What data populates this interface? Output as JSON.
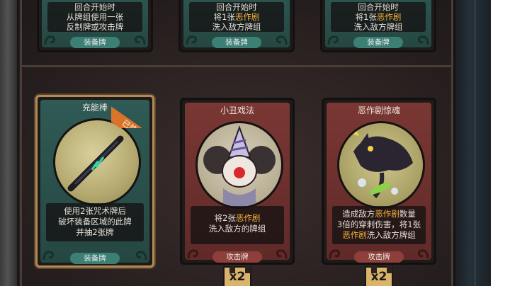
{
  "top_row": [
    {
      "lines": [
        {
          "segments": [
            {
              "text": "回合开始时",
              "hl": false
            }
          ]
        },
        {
          "segments": [
            {
              "text": "从牌组使用一张",
              "hl": false
            }
          ]
        },
        {
          "segments": [
            {
              "text": "反制牌或攻击牌",
              "hl": false
            }
          ]
        }
      ],
      "type_label": "装备牌"
    },
    {
      "lines": [
        {
          "segments": [
            {
              "text": "回合开始时",
              "hl": false
            }
          ]
        },
        {
          "segments": [
            {
              "text": "将1张",
              "hl": false
            },
            {
              "text": "恶作剧",
              "hl": true
            }
          ]
        },
        {
          "segments": [
            {
              "text": "洗入敌方牌组",
              "hl": false
            }
          ]
        }
      ],
      "type_label": "装备牌"
    },
    {
      "lines": [
        {
          "segments": [
            {
              "text": "回合开始时",
              "hl": false
            }
          ]
        },
        {
          "segments": [
            {
              "text": "将1张",
              "hl": false
            },
            {
              "text": "恶作剧",
              "hl": true
            }
          ]
        },
        {
          "segments": [
            {
              "text": "洗入敌方牌组",
              "hl": false
            }
          ]
        }
      ],
      "type_label": "装备牌"
    }
  ],
  "cards": [
    {
      "title": "充能棒",
      "badge": "已装备",
      "lines": [
        {
          "segments": [
            {
              "text": "使用2张咒术牌后",
              "hl": false
            }
          ]
        },
        {
          "segments": [
            {
              "text": "破坏装备区域的此牌",
              "hl": false
            }
          ]
        },
        {
          "segments": [
            {
              "text": "并抽2张牌",
              "hl": false
            }
          ]
        }
      ],
      "type_label": "装备牌",
      "count": ""
    },
    {
      "title": "小丑戏法",
      "lines": [
        {
          "segments": [
            {
              "text": "将2张",
              "hl": false
            },
            {
              "text": "恶作剧",
              "hl": true
            }
          ]
        },
        {
          "segments": [
            {
              "text": "洗入敌方的牌组",
              "hl": false
            }
          ]
        }
      ],
      "type_label": "攻击牌",
      "count": "x2"
    },
    {
      "title": "恶作剧惊魂",
      "lines": [
        {
          "segments": [
            {
              "text": "造成敌方",
              "hl": false
            },
            {
              "text": "恶作剧",
              "hl": true
            },
            {
              "text": "数量",
              "hl": false
            }
          ]
        },
        {
          "segments": [
            {
              "text": "3倍的穿刺伤害，将1张",
              "hl": false
            }
          ]
        },
        {
          "segments": [
            {
              "text": "恶作剧",
              "hl": true
            },
            {
              "text": "洗入敌方牌组",
              "hl": false
            }
          ]
        }
      ],
      "type_label": "攻击牌",
      "count": "x2"
    }
  ],
  "colors": {
    "highlight": "#f2b33d",
    "equip_frame": "#2f5a55",
    "attack_frame": "#7a3734",
    "badge": "#d9742a",
    "count_tag": "#d9b46a"
  }
}
